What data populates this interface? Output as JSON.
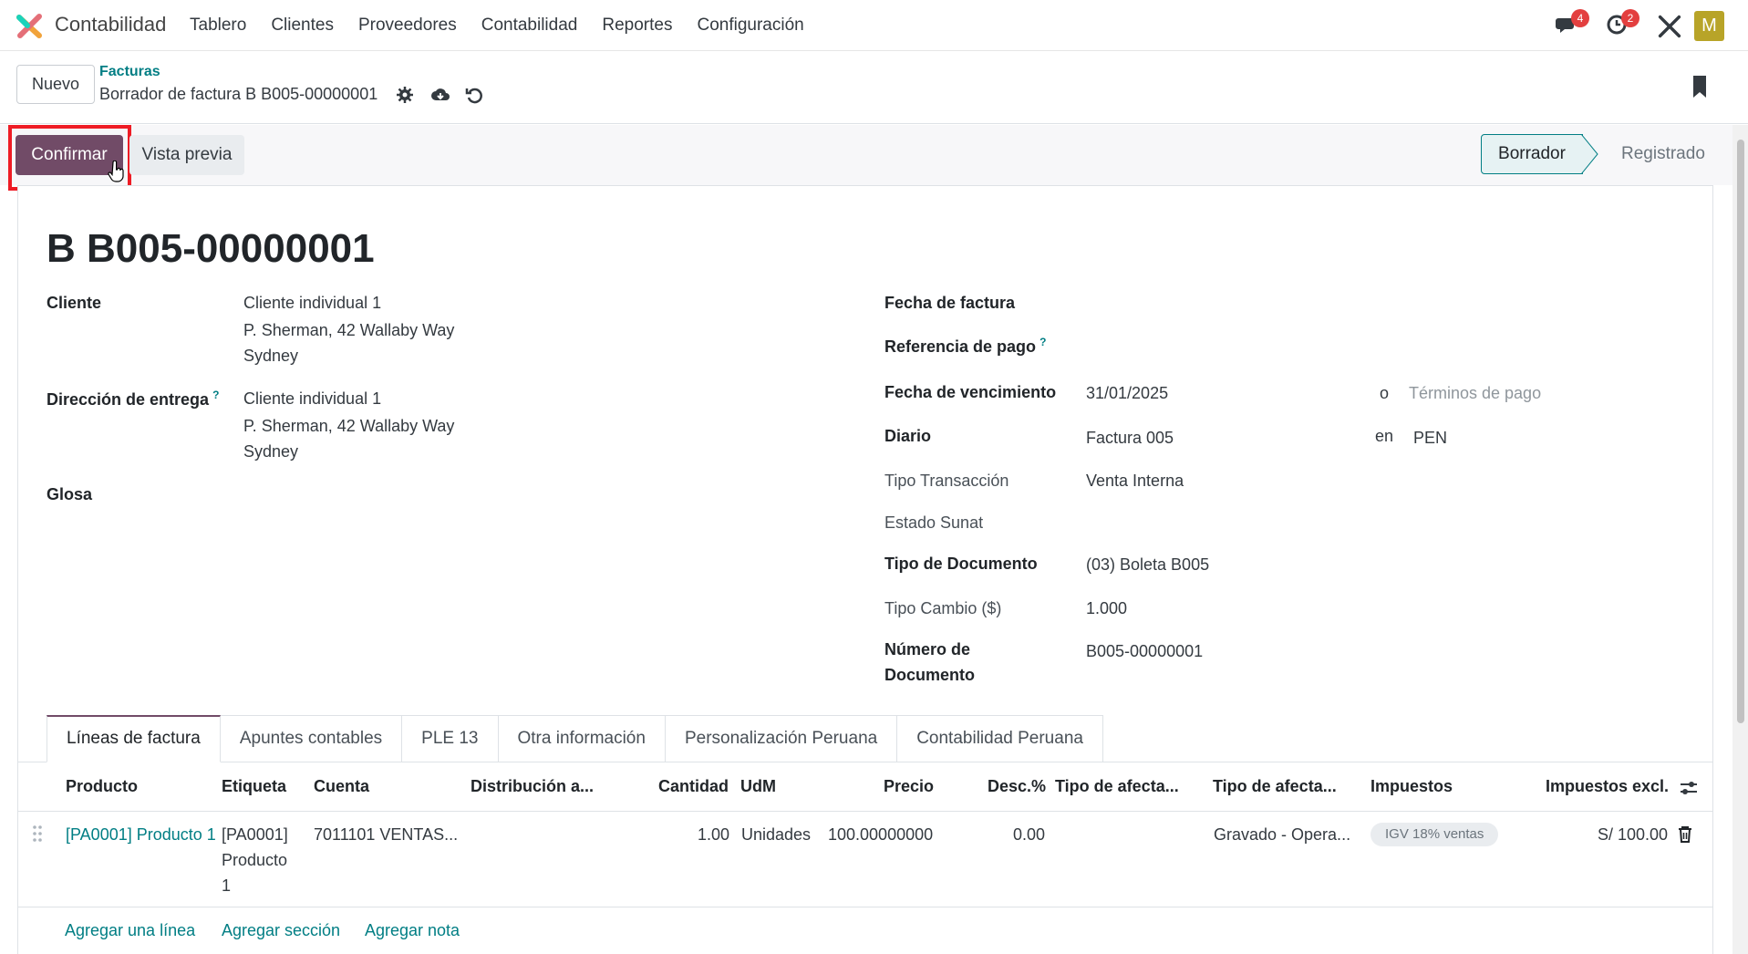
{
  "app": {
    "name": "Contabilidad",
    "menu": [
      "Tablero",
      "Clientes",
      "Proveedores",
      "Contabilidad",
      "Reportes",
      "Configuración"
    ],
    "messages_badge": "4",
    "activities_badge": "2",
    "avatar_letter": "M"
  },
  "control": {
    "new_label": "Nuevo",
    "breadcrumb_parent": "Facturas",
    "breadcrumb_current": "Borrador de factura B B005-00000001"
  },
  "statusbar": {
    "confirm_label": "Confirmar",
    "preview_label": "Vista previa",
    "step_active": "Borrador",
    "step_next": "Registrado"
  },
  "form": {
    "title": "B B005-00000001",
    "customer_label": "Cliente",
    "customer_lines": [
      "Cliente individual 1",
      "P. Sherman, 42 Wallaby Way",
      "Sydney"
    ],
    "delivery_label": "Dirección de entrega",
    "delivery_help": "?",
    "delivery_lines": [
      "Cliente individual 1",
      "P. Sherman, 42 Wallaby Way",
      "Sydney"
    ],
    "glosa_label": "Glosa",
    "invoice_date_label": "Fecha de factura",
    "payment_ref_label": "Referencia de pago",
    "payment_ref_help": "?",
    "due_date_label": "Fecha de vencimiento",
    "due_date_value": "31/01/2025",
    "or_label": "o",
    "payment_terms_placeholder": "Términos de pago",
    "journal_label": "Diario",
    "journal_value": "Factura 005",
    "in_label": "en",
    "currency_value": "PEN",
    "transaction_type_label": "Tipo Transacción",
    "transaction_type_value": "Venta Interna",
    "sunat_status_label": "Estado Sunat",
    "doc_type_label": "Tipo de Documento",
    "doc_type_value": "(03) Boleta B005",
    "exchange_label": "Tipo Cambio ($)",
    "exchange_value": "1.000",
    "doc_number_label_1": "Número de",
    "doc_number_label_2": "Documento",
    "doc_number_value": "B005-00000001"
  },
  "tabs": [
    "Líneas de factura",
    "Apuntes contables",
    "PLE 13",
    "Otra información",
    "Personalización Peruana",
    "Contabilidad Peruana"
  ],
  "table": {
    "headers": {
      "product": "Producto",
      "label": "Etiqueta",
      "account": "Cuenta",
      "distribution": "Distribución a...",
      "quantity": "Cantidad",
      "uom": "UdM",
      "price": "Precio",
      "discount": "Desc.%",
      "affect_type_1": "Tipo de afecta...",
      "affect_type_2": "Tipo de afecta...",
      "taxes": "Impuestos",
      "subtotal": "Impuestos excl."
    },
    "row": {
      "product": "[PA0001] Producto 1",
      "label_1": "[PA0001]",
      "label_2": "Producto",
      "label_3": "1",
      "account": "7011101 VENTAS...",
      "quantity": "1.00",
      "uom": "Unidades",
      "price": "100.00000000",
      "discount": "0.00",
      "affect_type_2": "Gravado - Opera...",
      "tax_tag": "IGV 18% ventas",
      "subtotal": "S/ 100.00"
    },
    "add_line": "Agregar una línea",
    "add_section": "Agregar sección",
    "add_note": "Agregar nota"
  }
}
